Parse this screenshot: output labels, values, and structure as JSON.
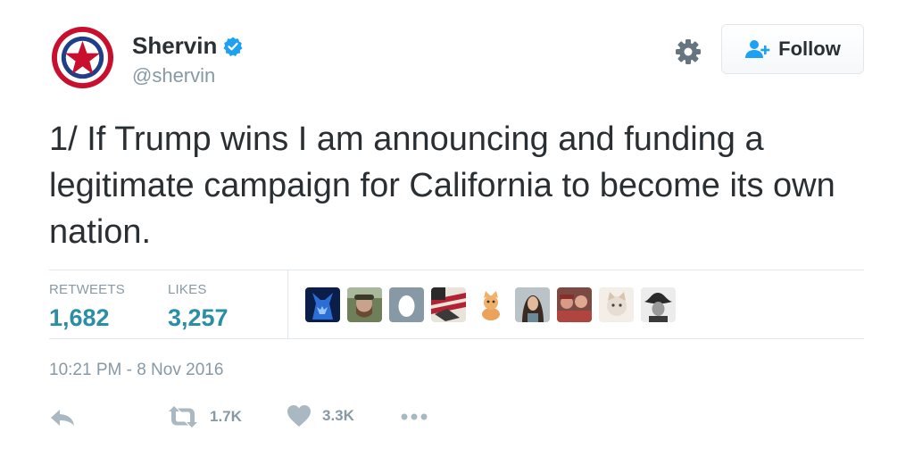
{
  "user": {
    "display_name": "Shervin",
    "handle": "@shervin",
    "verified": true,
    "avatar_icon": "star-roundel-avatar"
  },
  "header": {
    "follow_label": "Follow",
    "settings_icon": "gear-icon"
  },
  "tweet": {
    "text": "1/ If Trump wins I am announcing and funding a legitimate campaign for California to become its own nation."
  },
  "stats": {
    "retweets_label": "RETWEETS",
    "retweets_value": "1,682",
    "likes_label": "LIKES",
    "likes_value": "3,257"
  },
  "likers": [
    {
      "icon": "wolf-avatar"
    },
    {
      "icon": "man-beard-avatar"
    },
    {
      "icon": "default-egg-avatar"
    },
    {
      "icon": "flag-avatar"
    },
    {
      "icon": "kitten-avatar"
    },
    {
      "icon": "woman-avatar"
    },
    {
      "icon": "group-avatar"
    },
    {
      "icon": "cat-avatar"
    },
    {
      "icon": "cowboy-avatar"
    }
  ],
  "timestamp": "10:21 PM - 8 Nov 2016",
  "actions": {
    "reply_icon": "reply-icon",
    "retweet_count": "1.7K",
    "like_count": "3.3K",
    "more_icon": "more-icon"
  },
  "colors": {
    "accent": "#2a8ea5",
    "muted": "#8899a6",
    "text": "#292f33",
    "verified": "#1da1f2"
  }
}
